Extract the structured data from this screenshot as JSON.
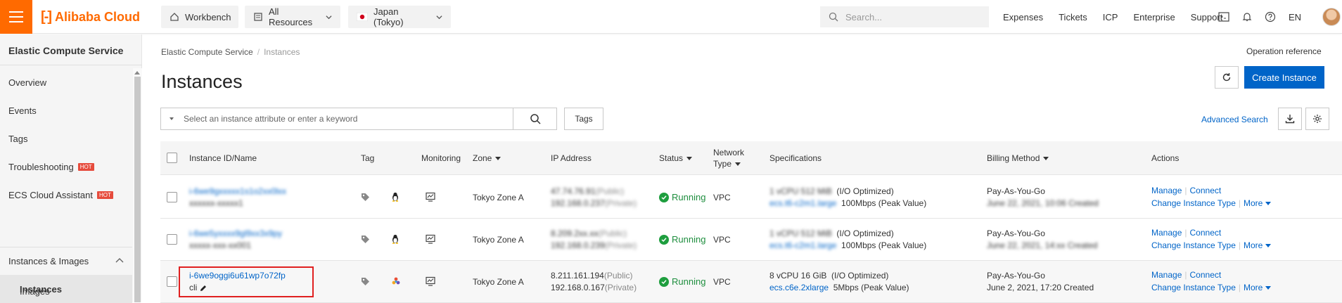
{
  "topbar": {
    "logo_text": "Alibaba Cloud",
    "workbench": "Workbench",
    "resources": "All Resources",
    "region": "Japan (Tokyo)",
    "search_placeholder": "Search...",
    "links": [
      "Expenses",
      "Tickets",
      "ICP",
      "Enterprise",
      "Support"
    ],
    "lang": "EN",
    "brand_color": "#ff6a00"
  },
  "sidebar": {
    "title": "Elastic Compute Service",
    "items": [
      {
        "label": "Overview"
      },
      {
        "label": "Events"
      },
      {
        "label": "Tags"
      },
      {
        "label": "Troubleshooting",
        "badge": "HOT"
      },
      {
        "label": "ECS Cloud Assistant",
        "badge": "HOT"
      }
    ],
    "section": "Instances & Images",
    "active": "Instances",
    "sub": "Images"
  },
  "main": {
    "breadcrumb": [
      "Elastic Compute Service",
      "Instances"
    ],
    "operation_reference": "Operation reference",
    "title": "Instances",
    "create_button": "Create Instance",
    "filter_placeholder": "Select an instance attribute or enter a keyword",
    "tags_button": "Tags",
    "advanced_search": "Advanced Search",
    "accent_color": "#0064c8"
  },
  "table": {
    "headers": {
      "id_name": "Instance ID/Name",
      "tag": "Tag",
      "monitoring": "Monitoring",
      "zone": "Zone",
      "ip": "IP Address",
      "status": "Status",
      "network_1": "Network",
      "network_2": "Type",
      "specs": "Specifications",
      "billing": "Billing Method",
      "actions": "Actions"
    },
    "rows": [
      {
        "id": "i-6we9gxxxxx1s1o2xx0lxx",
        "name": "xxxxxx-xxxxx1",
        "os_icon": "linux-tux-icon",
        "zone": "Tokyo Zone A",
        "ip_public": "47.74.76.91",
        "ip_public_tag": "(Public)",
        "ip_private": "192.168.0.237",
        "ip_private_tag": "(Private)",
        "status": "Running",
        "network": "VPC",
        "spec_cpu_mem": "1 vCPU 512 MiB",
        "spec_opt": "(I/O Optimized)",
        "spec_type": "ecs.t6-c2m1.large",
        "spec_bw": "100Mbps (Peak Value)",
        "billing": "Pay-As-You-Go",
        "created": "June 22, 2021, 10:06 Created",
        "action_manage": "Manage",
        "action_connect": "Connect",
        "action_change": "Change Instance Type",
        "action_more": "More",
        "blurred": true
      },
      {
        "id": "i-6we5yxxxx9gl9xx3x9py",
        "name": "xxxxx-xxx-xx001",
        "os_icon": "linux-tux-icon",
        "zone": "Tokyo Zone A",
        "ip_public": "8.209.2xx.xx",
        "ip_public_tag": "(Public)",
        "ip_private": "192.168.0.239",
        "ip_private_tag": "(Private)",
        "status": "Running",
        "network": "VPC",
        "spec_cpu_mem": "1 vCPU 512 MiB",
        "spec_opt": "(I/O Optimized)",
        "spec_type": "ecs.t6-c2m1.large",
        "spec_bw": "100Mbps (Peak Value)",
        "billing": "Pay-As-You-Go",
        "created": "June 22, 2021, 14:xx Created",
        "action_manage": "Manage",
        "action_connect": "Connect",
        "action_change": "Change Instance Type",
        "action_more": "More",
        "blurred": true
      },
      {
        "id": "i-6we9oggi6u61wp7o72fp",
        "name": "cli",
        "os_icon": "linux-distro-icon",
        "zone": "Tokyo Zone A",
        "ip_public": "8.211.161.194",
        "ip_public_tag": "(Public)",
        "ip_private": "192.168.0.167",
        "ip_private_tag": "(Private)",
        "status": "Running",
        "network": "VPC",
        "spec_cpu_mem": "8 vCPU 16 GiB",
        "spec_opt": "(I/O Optimized)",
        "spec_type": "ecs.c6e.2xlarge",
        "spec_bw": "5Mbps (Peak Value)",
        "billing": "Pay-As-You-Go",
        "created": "June 2, 2021, 17:20 Created",
        "action_manage": "Manage",
        "action_connect": "Connect",
        "action_change": "Change Instance Type",
        "action_more": "More",
        "blurred": false
      }
    ]
  }
}
